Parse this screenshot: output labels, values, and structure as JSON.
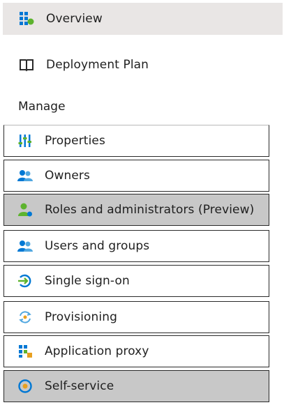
{
  "nav": {
    "overview_label": "Overview",
    "deployment_plan_label": "Deployment Plan"
  },
  "manage": {
    "heading": "Manage",
    "items": [
      {
        "label": "Properties",
        "icon": "properties-icon",
        "selected": false
      },
      {
        "label": "Owners",
        "icon": "owners-icon",
        "selected": false
      },
      {
        "label": "Roles and administrators (Preview)",
        "icon": "roles-icon",
        "selected": true
      },
      {
        "label": "Users and groups",
        "icon": "users-groups-icon",
        "selected": false
      },
      {
        "label": "Single sign-on",
        "icon": "sso-icon",
        "selected": false
      },
      {
        "label": "Provisioning",
        "icon": "provisioning-icon",
        "selected": false
      },
      {
        "label": "Application proxy",
        "icon": "app-proxy-icon",
        "selected": false
      },
      {
        "label": "Self-service",
        "icon": "self-service-icon",
        "selected": true
      }
    ]
  },
  "colors": {
    "selected_bg": "#c8c8c8",
    "overview_bg": "#e9e6e5",
    "azure_blue": "#0078d4",
    "green": "#5db32e"
  }
}
